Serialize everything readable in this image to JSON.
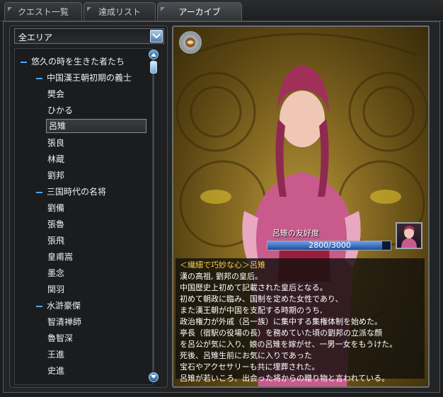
{
  "tabs": [
    {
      "label": "クエスト一覧"
    },
    {
      "label": "達成リスト"
    },
    {
      "label": "アーカイブ",
      "active": true
    }
  ],
  "area_select": {
    "value": "全エリア"
  },
  "tree": {
    "groups": [
      {
        "label": "悠久の時を生きた者たち"
      }
    ],
    "items": [
      {
        "label": "悠久の時を生きた者たち",
        "level": 0,
        "expanded": true
      },
      {
        "label": "中国漢王朝初期の義士",
        "level": 1,
        "expanded": true
      },
      {
        "label": "樊会",
        "level": 2
      },
      {
        "label": "ひかる",
        "level": 2
      },
      {
        "label": "呂雉",
        "level": 2,
        "selected": true
      },
      {
        "label": "張良",
        "level": 2
      },
      {
        "label": "林蔵",
        "level": 2
      },
      {
        "label": "劉邦",
        "level": 2
      },
      {
        "label": "三国時代の名将",
        "level": 1,
        "expanded": true
      },
      {
        "label": "劉備",
        "level": 2
      },
      {
        "label": "張魯",
        "level": 2
      },
      {
        "label": "張飛",
        "level": 2
      },
      {
        "label": "皇甫嵩",
        "level": 2
      },
      {
        "label": "墨念",
        "level": 2
      },
      {
        "label": "関羽",
        "level": 2
      },
      {
        "label": "水滸豪傑",
        "level": 1,
        "expanded": true
      },
      {
        "label": "智清禅師",
        "level": 2
      },
      {
        "label": "魯智深",
        "level": 2
      },
      {
        "label": "王進",
        "level": 2
      },
      {
        "label": "史進",
        "level": 2
      }
    ]
  },
  "character": {
    "affinity_label": "呂雉の友好度",
    "affinity_text": "2800/3000",
    "affinity_current": 2800,
    "affinity_max": 3000
  },
  "description": {
    "title": "＜繊細で巧妙な心＞呂雉",
    "lines": [
      "漢の高祖, 劉邦の皇后。",
      "中国歴史上初めて記載された皇后となる。",
      "初めて朝政に臨み、国制を定めた女性であり、",
      "また漢王朝が中国を支配する時期のうち,",
      "政治権力が外戚（呂一族）に集中する集権体制を始めた。",
      "亭長（宿駅の役場の長）を務めていた頃の劉邦の立派な顔",
      "を呂公が気に入り、娘の呂雉を嫁がせ、一男一女をもうけた。",
      "死後、呂雉生前にお気に入りであった",
      "宝石やアクセサリーも共に埋葬された。",
      "呂雉が若いころ、出会った将からの贈り物と言われている。"
    ]
  },
  "colors": {
    "accent": "#4da6ff",
    "highlight_text": "#f2d44c",
    "bar_fill": "#2f62b8"
  },
  "icons": {
    "dropdown": "chevron-down-icon",
    "emblem": "emblem-icon",
    "tree_toggle": "collapse-dash-icon"
  }
}
